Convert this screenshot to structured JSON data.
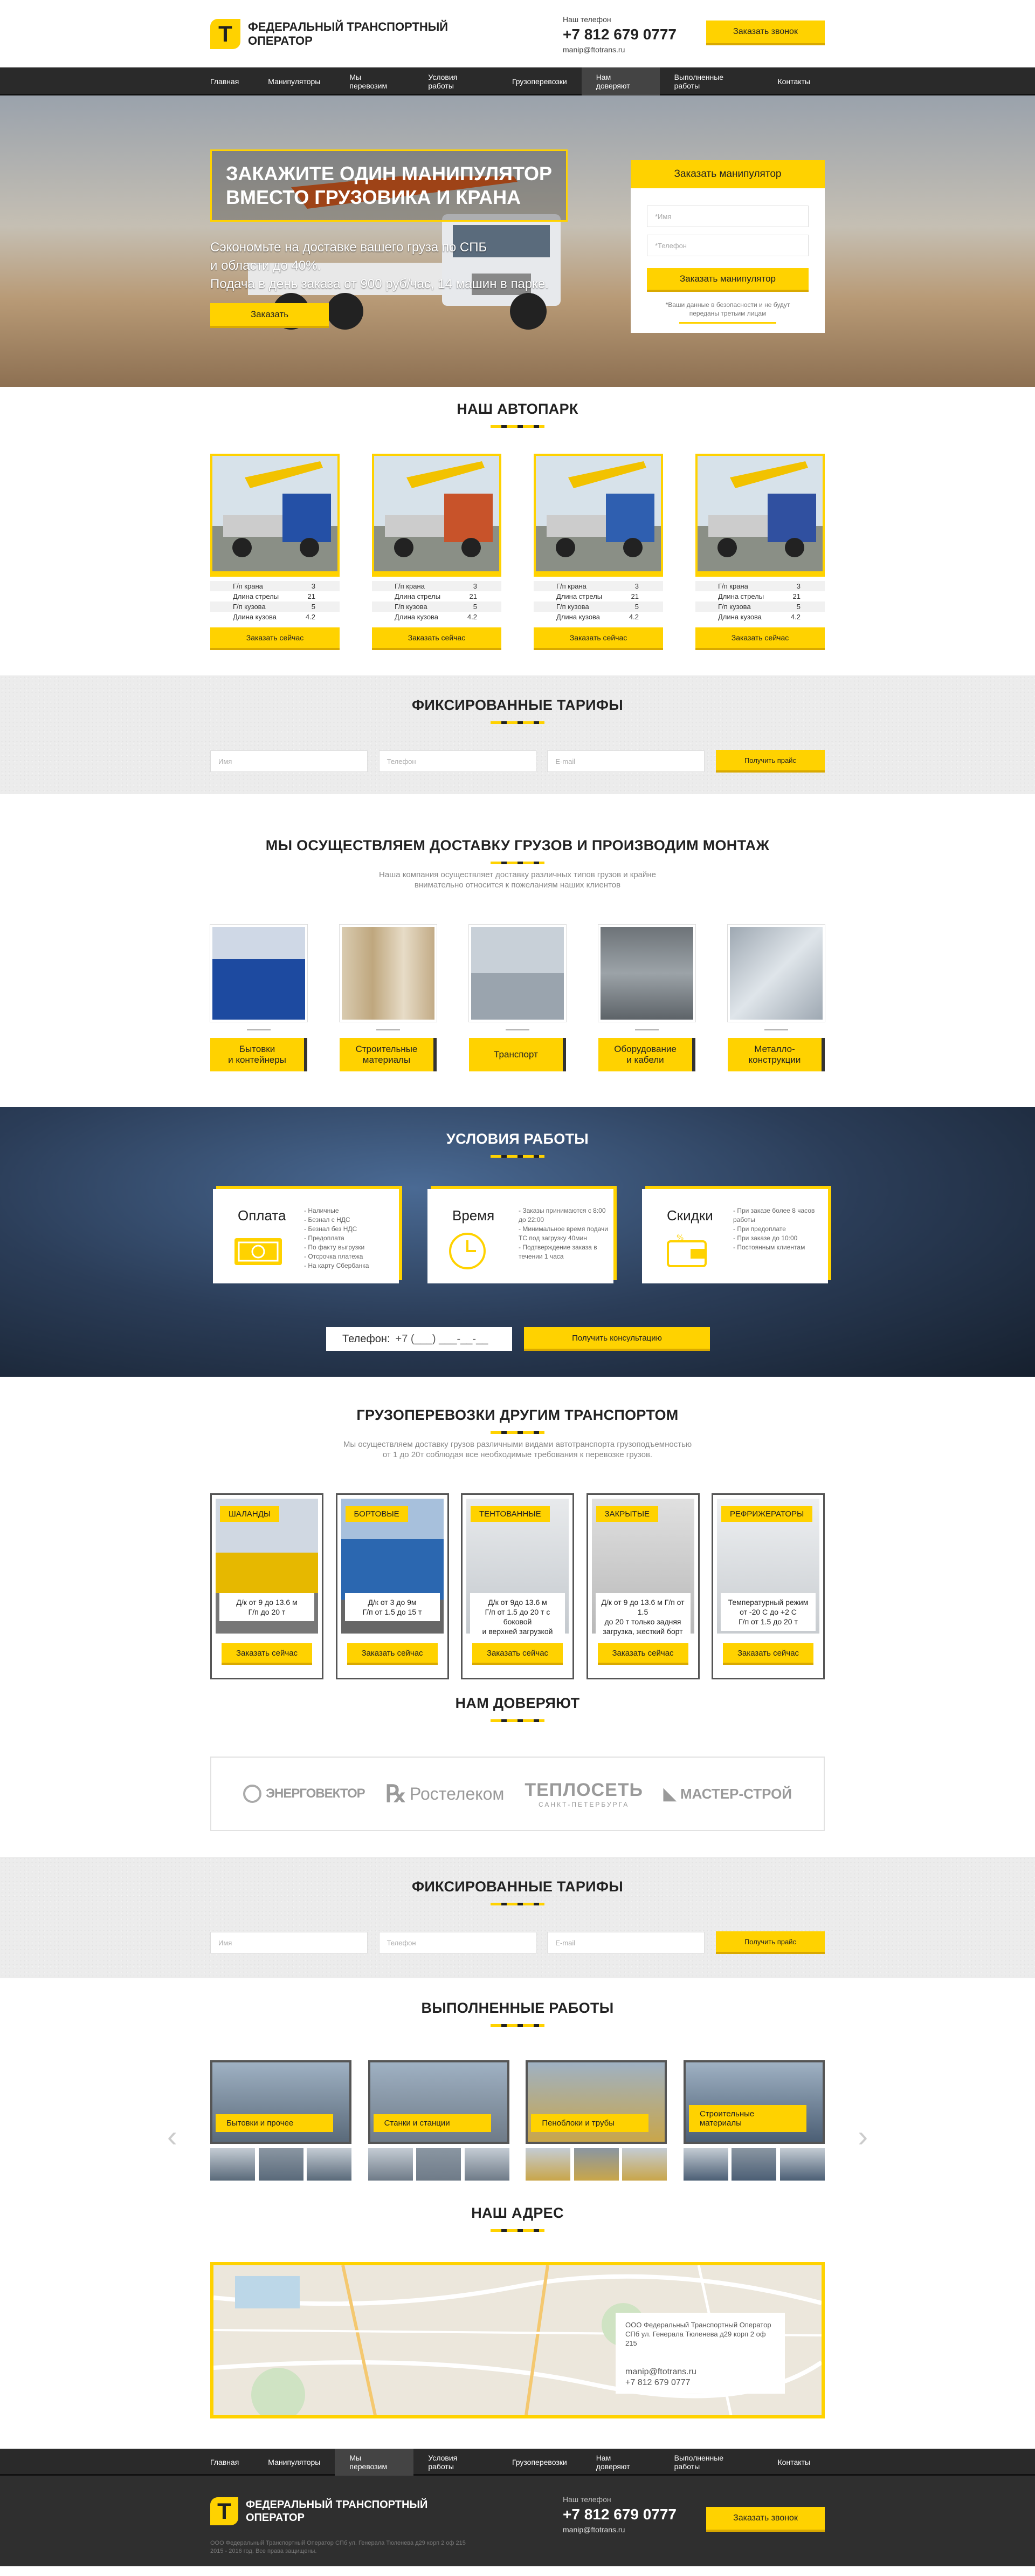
{
  "header": {
    "logo_mark": "T",
    "logo_line1": "Федеральный транспортный",
    "logo_line2": "оператор",
    "phone_label": "Наш телефон",
    "phone": "+7 812 679 0777",
    "email": "manip@ftotrans.ru",
    "call_button": "Заказать звонок"
  },
  "nav": [
    "Главная",
    "Манипуляторы",
    "Мы перевозим",
    "Условия работы",
    "Грузоперевозки",
    "Нам доверяют",
    "Выполненные работы",
    "Контакты"
  ],
  "hero": {
    "title_line1": "Закажите один манипулятор",
    "title_line2": "вместо грузовика и крана",
    "text_line1": "Сэкономьте на доставке вашего груза по СПБ",
    "text_line2": "и области до 40%.",
    "text_line3": "Подача в день заказа от 900 руб/час, 14 машин в парке.",
    "order_button": "Заказать",
    "form_title": "Заказать манипулятор",
    "name_placeholder": "*Имя",
    "phone_placeholder": "*Телефон",
    "form_button": "Заказать манипулятор",
    "form_note_line1": "*Ваши данные в безопасности и не будут",
    "form_note_line2": "переданы третьим лицам"
  },
  "fleet": {
    "title": "Наш автопарк",
    "cards": [
      {
        "specs": [
          [
            "Г/п крана",
            "3"
          ],
          [
            "Длина стрелы",
            "21"
          ],
          [
            "Г/п кузова",
            "5"
          ],
          [
            "Длина кузова",
            "4.2"
          ]
        ],
        "button": "Заказать сейчас"
      },
      {
        "specs": [
          [
            "Г/п крана",
            "3"
          ],
          [
            "Длина стрелы",
            "21"
          ],
          [
            "Г/п кузова",
            "5"
          ],
          [
            "Длина кузова",
            "4.2"
          ]
        ],
        "button": "Заказать сейчас"
      },
      {
        "specs": [
          [
            "Г/п крана",
            "3"
          ],
          [
            "Длина стрелы",
            "21"
          ],
          [
            "Г/п кузова",
            "5"
          ],
          [
            "Длина кузова",
            "4.2"
          ]
        ],
        "button": "Заказать сейчас"
      },
      {
        "specs": [
          [
            "Г/п крана",
            "3"
          ],
          [
            "Длина стрелы",
            "21"
          ],
          [
            "Г/п кузова",
            "5"
          ],
          [
            "Длина кузова",
            "4.2"
          ]
        ],
        "button": "Заказать сейчас"
      }
    ]
  },
  "tariffs": {
    "title": "Фиксированные тарифы",
    "name_placeholder": "Имя",
    "phone_placeholder": "Телефон",
    "email_placeholder": "E-mail",
    "button": "Получить прайс"
  },
  "delivery": {
    "title": "Мы осуществляем доставку грузов и производим монтаж",
    "sub_line1": "Наша компания осуществляет доставку различных типов грузов и крайне",
    "sub_line2": "внимательно относится к пожеланиям наших клиентов",
    "items": [
      [
        "Бытовки",
        "и контейнеры"
      ],
      [
        "Строительные",
        "материалы"
      ],
      [
        "Транспорт",
        ""
      ],
      [
        "Оборудование",
        "и кабели"
      ],
      [
        "Металло-",
        "конструкции"
      ]
    ]
  },
  "conditions": {
    "title": "Условия работы",
    "cards": [
      {
        "title": "Оплата",
        "items": [
          "Наличные",
          "Безнал с НДС",
          "Безнал без НДС",
          "Предоплата",
          "По факту выгрузки",
          "Отсрочка платежа",
          "На карту Сбербанка"
        ]
      },
      {
        "title": "Время",
        "items": [
          "Заказы принимаются с 8:00 до 22:00",
          "Минимальное время подачи ТС под загрузку 40мин",
          "Подтверждение заказа в течении 1 часа"
        ]
      },
      {
        "title": "Скидки",
        "items": [
          "При заказе более 8 часов работы",
          "При предоплате",
          "При заказе до 10:00",
          "Постоянным клиентам"
        ]
      }
    ],
    "phone_label": "Телефон:",
    "phone_mask": "+7 (___) ___-__-__",
    "button": "Получить консультацию"
  },
  "transport": {
    "title": "Грузоперевозки другим транспортом",
    "sub_line1": "Мы осуществляем доставку грузов различными видами автотранспорта грузоподъемностью",
    "sub_line2": "от 1 до 20т соблюдая все необходимые требования к перевозке грузов.",
    "cards": [
      {
        "label": "Шаланды",
        "info": [
          "Д/к от 9 до 13.6 м",
          "Г/п до 20 т"
        ],
        "button": "Заказать сейчас"
      },
      {
        "label": "Бортовые",
        "info": [
          "Д/к от 3 до 9м",
          "Г/п от 1.5 до 15 т"
        ],
        "button": "Заказать сейчас"
      },
      {
        "label": "Тентованные",
        "info": [
          "Д/к от 9до 13.6 м",
          "Г/п от 1.5 до 20 т с боковой",
          "и верхней загрузкой"
        ],
        "button": "Заказать сейчас"
      },
      {
        "label": "Закрытые",
        "info": [
          "Д/к от 9 до 13.6 м Г/п от 1.5",
          "до 20 т только задняя",
          "загрузка, жесткий борт"
        ],
        "button": "Заказать сейчас"
      },
      {
        "label": "Рефрижераторы",
        "info": [
          "Температурный режим",
          "от -20 С до +2 С",
          "Г/п от 1.5 до 20 т"
        ],
        "button": "Заказать сейчас"
      }
    ]
  },
  "trust": {
    "title": "Нам доверяют",
    "logos": [
      "ЭНЕРГОВЕКТОР",
      "Ростелеком",
      "ТЕПЛОСЕТЬ",
      "МАСТЕР-СТРОЙ"
    ],
    "logo3_sub": "САНКТ-ПЕТЕРБУРГА"
  },
  "works": {
    "title": "Выполненные работы",
    "items": [
      "Бытовки и прочее",
      "Станки и станции",
      "Пеноблоки и трубы",
      "Строительные материалы"
    ]
  },
  "address": {
    "title": "Наш адрес",
    "line1": "ООО Федеральный Транспортный Оператор",
    "line2": "СПб ул. Генерала Тюленева д29 корп 2 оф 215",
    "email": "manip@ftotrans.ru",
    "phone": "+7 812 679 0777"
  },
  "footer": {
    "copy_line1": "ООО Федеральный Транспортный Оператор СПб ул. Генерала Тюленева д29 корп 2 оф 215",
    "copy_line2": "2015 - 2016 год. Все права защищены."
  },
  "colors": {
    "accent": "#ffd200",
    "dark": "#2a2a2a"
  }
}
